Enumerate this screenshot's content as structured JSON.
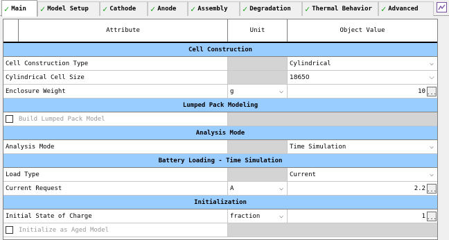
{
  "tabs": [
    {
      "label": "Main",
      "checked": true,
      "active": true
    },
    {
      "label": "Model Setup",
      "checked": true
    },
    {
      "label": "Cathode",
      "checked": true
    },
    {
      "label": "Anode",
      "checked": true
    },
    {
      "label": "Assembly",
      "checked": true
    },
    {
      "label": "Degradation",
      "checked": true
    },
    {
      "label": "Thermal Behavior",
      "checked": true
    },
    {
      "label": "Advanced",
      "checked": true
    }
  ],
  "tab_icon": "chart-icon",
  "check_glyph": "✓",
  "header": {
    "attribute": "Attribute",
    "unit": "Unit",
    "value": "Object Value"
  },
  "sections": {
    "cell_construction": "Cell Construction",
    "lumped_pack": "Lumped Pack Modeling",
    "analysis_mode": "Analysis Mode",
    "battery_loading": "Battery Loading - Time Simulation",
    "initialization": "Initialization"
  },
  "rows": {
    "cell_construction_type": {
      "label": "Cell Construction Type",
      "value": "Cylindrical"
    },
    "cylindrical_cell_size": {
      "label": "Cylindrical Cell Size",
      "value": "18650"
    },
    "enclosure_weight": {
      "label": "Enclosure Weight",
      "unit": "g",
      "value": "10"
    },
    "build_lumped_pack": {
      "label": "Build Lumped Pack Model"
    },
    "analysis_mode": {
      "label": "Analysis Mode",
      "value": "Time Simulation"
    },
    "load_type": {
      "label": "Load Type",
      "value": "Current"
    },
    "current_request": {
      "label": "Current Request",
      "unit": "A",
      "value": "2.2"
    },
    "initial_soc": {
      "label": "Initial State of Charge",
      "unit": "fraction",
      "value": "1"
    },
    "init_aged": {
      "label": "Initialize as Aged Model"
    }
  },
  "glyphs": {
    "dropdown": "⌵",
    "ellipsis": "..."
  },
  "colors": {
    "section_bg": "#99ccff",
    "check": "#1aa51a",
    "disabled_bg": "#d4d4d4"
  }
}
